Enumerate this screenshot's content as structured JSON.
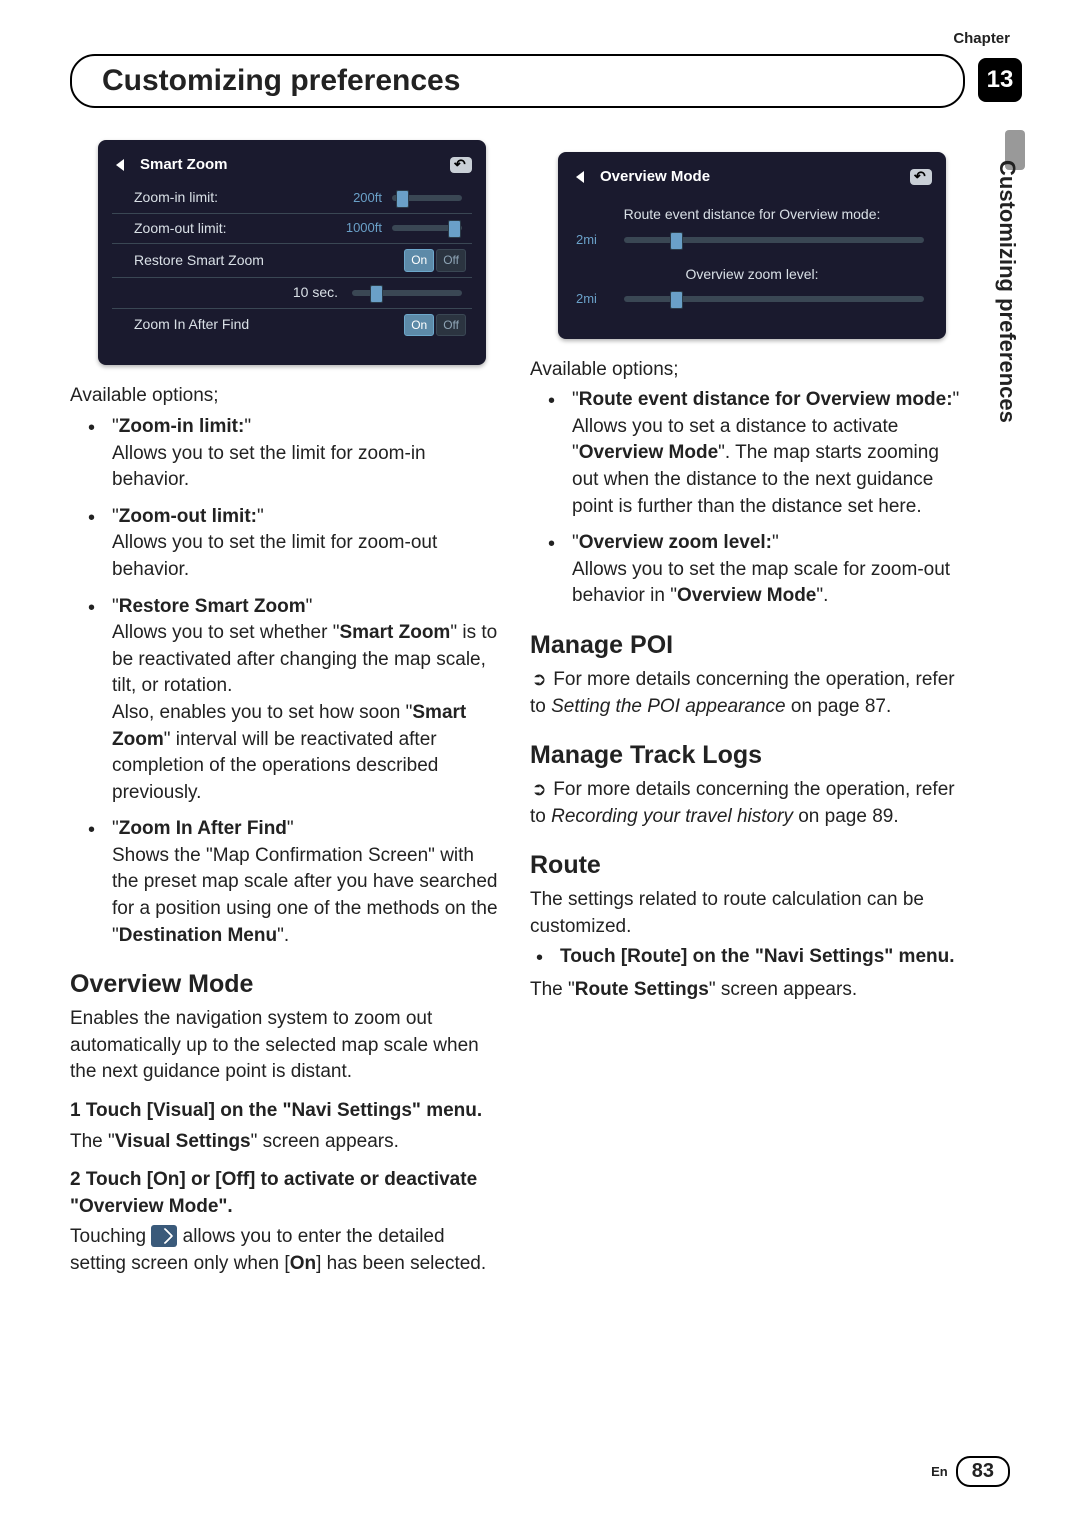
{
  "chapter_label": "Chapter",
  "chapter_number": "13",
  "header_title": "Customizing preferences",
  "side_label": "Customizing preferences",
  "smart_zoom_screen": {
    "title": "Smart Zoom",
    "rows": {
      "zoom_in_limit_label": "Zoom-in limit:",
      "zoom_in_limit_value": "200ft",
      "zoom_out_limit_label": "Zoom-out limit:",
      "zoom_out_limit_value": "1000ft",
      "restore_label": "Restore Smart Zoom",
      "restore_on": "On",
      "restore_off": "Off",
      "restore_time": "10 sec.",
      "zoom_after_find_label": "Zoom In After Find",
      "zoom_after_find_on": "On",
      "zoom_after_find_off": "Off"
    }
  },
  "overview_screen": {
    "title": "Overview Mode",
    "route_event_label": "Route event distance for Overview mode:",
    "route_event_value": "2mi",
    "zoom_level_label": "Overview zoom level:",
    "zoom_level_value": "2mi"
  },
  "col_left": {
    "available": "Available options;",
    "bullets": {
      "b1_title": "Zoom-in limit:",
      "b1_body": "Allows you to set the limit for zoom-in behavior.",
      "b2_title": "Zoom-out limit:",
      "b2_body": "Allows you to set the limit for zoom-out behavior.",
      "b3_title": "Restore Smart Zoom",
      "b3_body_1a": "Allows you to set whether \"",
      "b3_body_1b": "Smart Zoom",
      "b3_body_1c": "\" is to be reactivated after changing the map scale, tilt, or rotation.",
      "b3_body_2a": "Also, enables you to set how soon \"",
      "b3_body_2b": "Smart Zoom",
      "b3_body_2c": "\" interval will be reactivated after completion of the operations described previously.",
      "b4_title": "Zoom In After Find",
      "b4_body_a": "Shows the \"Map Confirmation Screen\" with the preset map scale after you have searched for a position using one of the methods on the \"",
      "b4_body_b": "Destination Menu",
      "b4_body_c": "\"."
    },
    "overview_heading": "Overview Mode",
    "overview_intro": "Enables the navigation system to zoom out automatically up to the selected map scale when the next guidance point is distant.",
    "step1_label": "1   Touch [Visual] on the \"Navi Settings\" menu.",
    "step1_body_a": "The \"",
    "step1_body_b": "Visual Settings",
    "step1_body_c": "\" screen appears.",
    "step2_label": "2   Touch [On] or [Off] to activate or deactivate \"Overview Mode\".",
    "step2_body_a": "Touching ",
    "step2_body_b": " allows you to enter the detailed setting screen only when [",
    "step2_body_c": "On",
    "step2_body_d": "] has been selected."
  },
  "col_right": {
    "available": "Available options;",
    "bullets": {
      "b1_title": "Route event distance for Overview mode:",
      "b1_body_a": "Allows you to set a distance to activate \"",
      "b1_body_b": "Overview Mode",
      "b1_body_c": "\". The map starts zooming out when the distance to the next guidance point is further than the distance set here.",
      "b2_title": "Overview zoom level:",
      "b2_body_a": "Allows you to set the map scale for zoom-out behavior in \"",
      "b2_body_b": "Overview Mode",
      "b2_body_c": "\"."
    },
    "poi_heading": "Manage POI",
    "poi_body_a": "For more details concerning the operation, refer to ",
    "poi_body_it": "Setting the POI appearance",
    "poi_body_b": " on page 87.",
    "track_heading": "Manage Track Logs",
    "track_body_a": "For more details concerning the operation, refer to ",
    "track_body_it": "Recording your travel history",
    "track_body_b": " on page 89.",
    "route_heading": "Route",
    "route_intro": "The settings related to route calculation can be customized.",
    "route_step_label": "Touch [Route] on the \"Navi Settings\" menu.",
    "route_step_body_a": "The \"",
    "route_step_body_b": "Route Settings",
    "route_step_body_c": "\" screen appears."
  },
  "footer": {
    "lang": "En",
    "page": "83"
  }
}
